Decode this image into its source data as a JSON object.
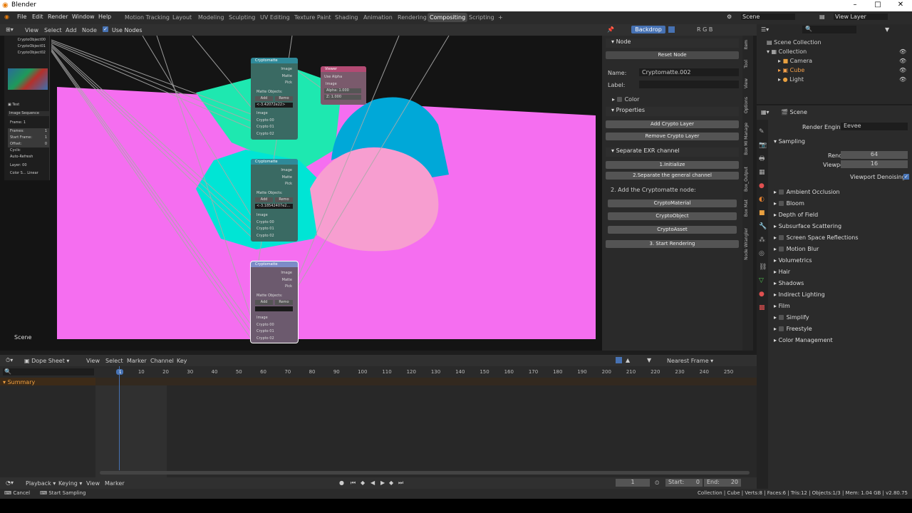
{
  "app_title": "Blender",
  "window_controls": {
    "minimize": "–",
    "maximize": "□",
    "close": "✕"
  },
  "menu": [
    "File",
    "Edit",
    "Render",
    "Window",
    "Help"
  ],
  "workspaces": [
    "Motion Tracking",
    "Layout",
    "Modeling",
    "Sculpting",
    "UV Editing",
    "Texture Paint",
    "Shading",
    "Animation",
    "Rendering",
    "Compositing",
    "Scripting"
  ],
  "active_workspace": "Compositing",
  "add_workspace": "+",
  "scene_name": "Scene",
  "view_layer": "View Layer",
  "node_header": {
    "view": "View",
    "select": "Select",
    "add": "Add",
    "node": "Node",
    "use_nodes": "Use Nodes",
    "backdrop": "Backdrop",
    "channels": "R G B"
  },
  "left_panel": {
    "crypto_items": [
      "CryptoObject00",
      "CryptoObject01",
      "CryptoObject02"
    ],
    "image_name": "Test",
    "source": "Image Sequence",
    "frame": "Frame: 1",
    "frames_label": "Frames:",
    "frames_val": "1",
    "start_label": "Start Frame:",
    "start_val": "1",
    "offset_label": "Offset:",
    "offset_val": "0",
    "cyclic": "Cyclic",
    "auto_refresh": "Auto-Refresh",
    "layer_label": "Layer:",
    "layer_val": "00",
    "color_label": "Color S...",
    "color_val": "Linear"
  },
  "scene_label": "Scene",
  "nodes": {
    "crypto_title": "Cryptomatte",
    "viewer_title": "Viewer",
    "outputs": [
      "Image",
      "Matte",
      "Pick"
    ],
    "matte_objects": "Matte Objects:",
    "add": "Add",
    "remove": "Remo",
    "inputs": [
      "Image",
      "Crypto 00",
      "Crypto 01",
      "Crypto 02"
    ],
    "matte_vals": [
      "<-3.42072e22>",
      "<-3.18542407e2...",
      ""
    ],
    "use_alpha": "Use Alpha",
    "image": "Image",
    "alpha_label": "Alpha:",
    "alpha_val": "1.000",
    "z_label": "Z:",
    "z_val": "1.000"
  },
  "npanel": {
    "node_section": "Node",
    "reset_node": "Reset Node",
    "name_label": "Name:",
    "name_val": "Cryptomatte.002",
    "label_label": "Label:",
    "color": "Color",
    "properties": "Properties",
    "add_layer": "Add Crypto Layer",
    "remove_layer": "Remove Crypto Layer",
    "sep_exr": "Separate EXR channel",
    "init": "1.Initialize",
    "separate": "2.Separate the general channel",
    "add_node": "2. Add the Cryptomatte node:",
    "crypto_material": "CryptoMaterial",
    "crypto_object": "CryptoObject",
    "crypto_asset": "CryptoAsset",
    "start_render": "3. Start Rendering"
  },
  "vtabs": [
    "Item",
    "Tool",
    "View",
    "Options",
    "Box MI Manage",
    "Box_Output",
    "Box Mat",
    "Node Wrangler"
  ],
  "outliner": {
    "scene_collection": "Scene Collection",
    "collection": "Collection",
    "items": [
      "Camera",
      "Cube",
      "Light"
    ]
  },
  "properties": {
    "scene": "Scene",
    "render_engine_label": "Render Engine",
    "render_engine": "Eevee",
    "sampling": "Sampling",
    "render_label": "Render",
    "render_val": "64",
    "viewport_label": "Viewport",
    "viewport_val": "16",
    "viewport_denoising": "Viewport Denoising",
    "panels": [
      "Ambient Occlusion",
      "Bloom",
      "Depth of Field",
      "Subsurface Scattering",
      "Screen Space Reflections",
      "Motion Blur",
      "Volumetrics",
      "Hair",
      "Shadows",
      "Indirect Lighting",
      "Film",
      "Simplify",
      "Freestyle",
      "Color Management"
    ]
  },
  "timeline": {
    "editor": "Dope Sheet",
    "menus": [
      "View",
      "Select",
      "Marker",
      "Channel",
      "Key"
    ],
    "snap": "Nearest Frame",
    "ticks": [
      "1",
      "10",
      "20",
      "30",
      "40",
      "50",
      "60",
      "70",
      "80",
      "90",
      "100",
      "110",
      "120",
      "130",
      "140",
      "150",
      "160",
      "170",
      "180",
      "190",
      "200",
      "210",
      "220",
      "230",
      "240",
      "250"
    ],
    "summary": "Summary"
  },
  "playback": {
    "menus": [
      "Playback",
      "Keying",
      "View",
      "Marker"
    ],
    "current": "1",
    "start_label": "Start:",
    "start_val": "0",
    "end_label": "End:",
    "end_val": "20"
  },
  "status": {
    "cancel": "Cancel",
    "start_sampling": "Start Sampling",
    "stats": "Collection | Cube | Verts:8 | Faces:6 | Tris:12 | Objects:1/3 | Mem: 1.04 GB | v2.80.75"
  },
  "colors": {
    "accent": "#4772b3",
    "backdrop_bg": "#f56ef0",
    "cyan": "#00e5d5",
    "green": "#1ee8b0",
    "blue": "#00a8d8",
    "pink": "#f79ed0"
  }
}
